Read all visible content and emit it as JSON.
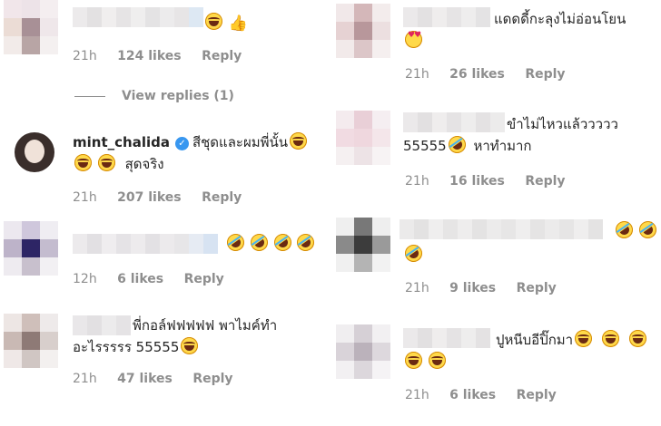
{
  "left_comments": [
    {
      "id": "c1",
      "text": "",
      "emojis": [
        "laugh",
        "thumbs"
      ],
      "meta": {
        "time": "21h",
        "likes": "124 likes",
        "reply": "Reply"
      }
    },
    {
      "id": "c2",
      "username": "mint_chalida",
      "line1": "สีชุดและผมพี่นั้น",
      "line2": "สุดจริง",
      "meta": {
        "time": "21h",
        "likes": "207 likes",
        "reply": "Reply"
      }
    },
    {
      "id": "c3",
      "text": "",
      "meta": {
        "time": "12h",
        "likes": "6 likes",
        "reply": "Reply"
      }
    },
    {
      "id": "c4",
      "line1": "พี่กอล์ฟฟฟฟฟ พาไมค์ทำ",
      "line2": "อะไรรรรร 55555",
      "meta": {
        "time": "21h",
        "likes": "47 likes",
        "reply": "Reply"
      }
    }
  ],
  "view_replies": "View replies (1)",
  "right_comments": [
    {
      "id": "r1",
      "line1": "แดดดี้กะลุงไม่อ่อนโยน",
      "meta": {
        "time": "21h",
        "likes": "26 likes",
        "reply": "Reply"
      }
    },
    {
      "id": "r2",
      "line1": "ขำไม่ไหวแล้ววววว",
      "line2a": "55555",
      "line2b": "หาทำมาก",
      "meta": {
        "time": "21h",
        "likes": "16 likes",
        "reply": "Reply"
      }
    },
    {
      "id": "r3",
      "meta": {
        "time": "21h",
        "likes": "9 likes",
        "reply": "Reply"
      }
    },
    {
      "id": "r4",
      "line1": "ปูหนีบอีปิ๊กมา",
      "meta": {
        "time": "21h",
        "likes": "6 likes",
        "reply": "Reply"
      }
    }
  ],
  "icons": {
    "verified": "verified-badge-icon",
    "laugh": "face-with-tears-of-joy-icon",
    "rofl": "rolling-on-floor-laughing-icon",
    "heart_eyes": "heart-eyes-icon",
    "thumbs_up": "thumbs-up-icon"
  },
  "colors": {
    "meta_gray": "#8e8e8e",
    "text": "#262626",
    "verified_blue": "#3897f0"
  }
}
